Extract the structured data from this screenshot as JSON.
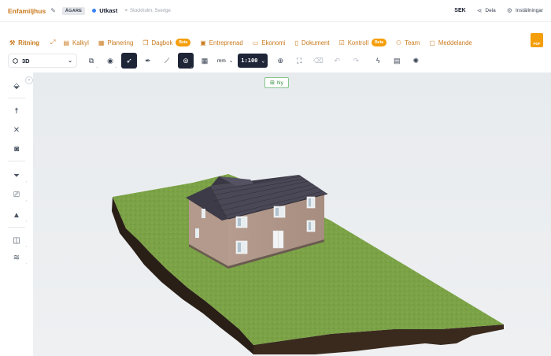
{
  "topbar": {
    "project_name": "Enfamiljhus",
    "role_badge": "ÄGARE",
    "status": "Utkast",
    "location": "Stockholm, Sverige",
    "currency": "SEK",
    "share_label": "Dela",
    "settings_label": "Inställningar"
  },
  "tabs": [
    {
      "label": "Ritning",
      "icon": "ruler-icon"
    },
    {
      "label": "Kalkyl",
      "icon": "calculator-icon"
    },
    {
      "label": "Planering",
      "icon": "calendar-icon"
    },
    {
      "label": "Dagbok",
      "icon": "book-icon",
      "badge": "Beta"
    },
    {
      "label": "Entreprenad",
      "icon": "briefcase-icon"
    },
    {
      "label": "Ekonomi",
      "icon": "wallet-icon"
    },
    {
      "label": "Dokument",
      "icon": "document-icon"
    },
    {
      "label": "Kontroll",
      "icon": "checklist-icon",
      "badge": "Beta"
    },
    {
      "label": "Team",
      "icon": "users-icon"
    },
    {
      "label": "Meddelande",
      "icon": "message-icon"
    }
  ],
  "pdf_label": "PDF",
  "toolbar": {
    "view_mode": "3D",
    "unit": "mm",
    "scale": "1:100"
  },
  "viewport": {
    "new_button_label": "Ny"
  },
  "colors": {
    "accent": "#c97a1e",
    "beta_badge": "#f59e0b",
    "dark_tool": "#1e2537",
    "status_dot": "#3b82f6"
  }
}
